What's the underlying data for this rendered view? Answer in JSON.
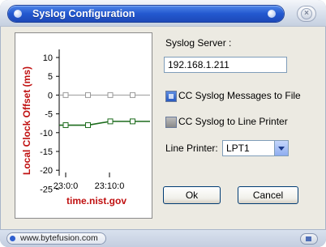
{
  "window": {
    "title": "Syslog Configuration",
    "close_icon": "close-icon"
  },
  "chart_data": {
    "type": "line",
    "ylabel": "Local Clock Offset (ms)",
    "xlabel": "time.nist.gov",
    "y_ticks": [
      "10",
      "5",
      "0",
      "-5",
      "-10",
      "-15",
      "-20",
      "-25"
    ],
    "x_ticks": [
      "23:0:0",
      "23:10:0"
    ],
    "ylim": [
      -25,
      12
    ],
    "grid": false,
    "series": [
      {
        "color": "#9a9a9a",
        "marker": "square",
        "points": [
          [
            0,
            0
          ],
          [
            1,
            0
          ],
          [
            2,
            0
          ],
          [
            3,
            0
          ]
        ]
      },
      {
        "color": "#1c6b1c",
        "marker": "square",
        "points": [
          [
            0,
            -8
          ],
          [
            1,
            -8
          ],
          [
            2,
            -7
          ],
          [
            3,
            -7
          ]
        ]
      }
    ]
  },
  "form": {
    "server_label": "Syslog Server :",
    "server_value": "192.168.1.211",
    "file_checkbox_label": "CC Syslog Messages to File",
    "file_checkbox_checked": true,
    "printer_checkbox_label": "CC Syslog  to Line Printer",
    "printer_checkbox_checked": false,
    "line_printer_label": "Line Printer:",
    "line_printer_value": "LPT1"
  },
  "buttons": {
    "ok": "Ok",
    "cancel": "Cancel"
  },
  "statusbar": {
    "link": "www.bytefusion.com"
  },
  "colors": {
    "title_accent": "#2358cf",
    "chart_label_red": "#c01010",
    "series_green": "#1c6b1c"
  }
}
